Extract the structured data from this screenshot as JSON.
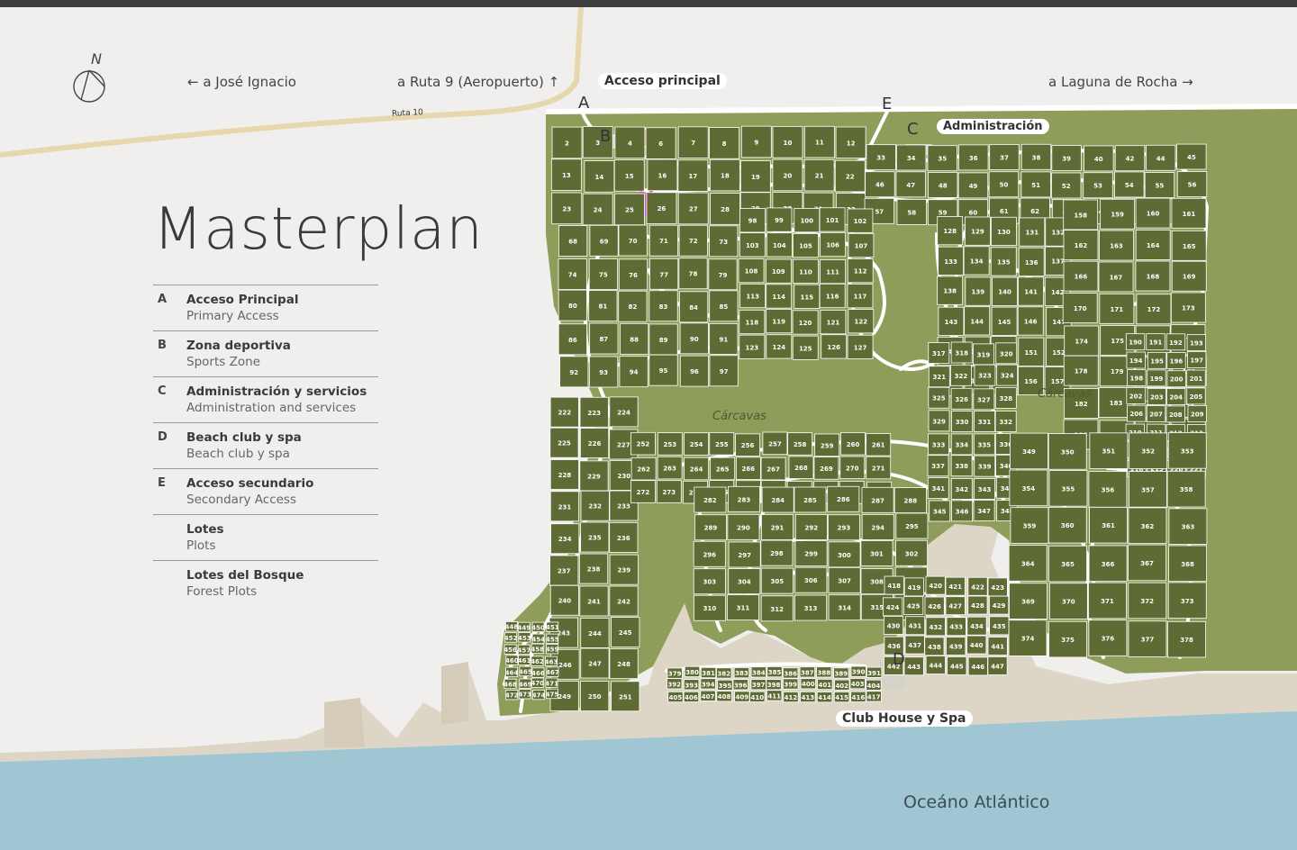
{
  "title": "Masterplan",
  "legend": [
    {
      "key": "A",
      "es": "Acceso Principal",
      "en": "Primary Access"
    },
    {
      "key": "B",
      "es": "Zona deportiva",
      "en": "Sports Zone"
    },
    {
      "key": "C",
      "es": "Administración y servicios",
      "en": "Administration and services"
    },
    {
      "key": "D",
      "es": "Beach club y spa",
      "en": "Beach club y spa"
    },
    {
      "key": "E",
      "es": "Acceso secundario",
      "en": "Secondary Access"
    },
    {
      "key": "",
      "es": "Lotes",
      "en": "Plots"
    },
    {
      "key": "",
      "es": "Lotes del Bosque",
      "en": "Forest Plots"
    }
  ],
  "compass": {
    "label": "N"
  },
  "directions": {
    "jose_ignacio": "← a José Ignacio",
    "ruta9": "a Ruta 9 (Aeropuerto) ↑",
    "laguna": "a Laguna de Rocha →"
  },
  "road_label": "Ruta 10",
  "places": {
    "acceso_principal": "Acceso principal",
    "administracion": "Administración",
    "club_house": "Club House y Spa",
    "ocean": "Oceáno Atlántico",
    "carcavas_1": "Cárcavas",
    "carcavas_2": "Cárcavas"
  },
  "points": {
    "A": "A",
    "B": "B",
    "C": "C",
    "D": "D",
    "E": "E"
  },
  "colors": {
    "background": "#f0efed",
    "land": "#8f9d5b",
    "plots": "#5f6b35",
    "roads": "#ffffff",
    "sand": "#ddd6c6",
    "ocean": "#9fc6d2",
    "highlight": "#d44fd0"
  },
  "plot_numbers": [
    "2",
    "3",
    "4",
    "6",
    "7",
    "8",
    "9",
    "10",
    "11",
    "12",
    "13",
    "14",
    "15",
    "16",
    "17",
    "18",
    "19",
    "20",
    "21",
    "22",
    "23",
    "24",
    "25",
    "26",
    "27",
    "28",
    "29",
    "30",
    "31",
    "32",
    "33",
    "34",
    "35",
    "36",
    "37",
    "38",
    "39",
    "40",
    "42",
    "44",
    "45",
    "46",
    "47",
    "48",
    "49",
    "50",
    "51",
    "52",
    "53",
    "54",
    "55",
    "56",
    "57",
    "58",
    "59",
    "60",
    "61",
    "62",
    "63",
    "64",
    "65",
    "66",
    "67",
    "68",
    "69",
    "70",
    "71",
    "72",
    "73",
    "74",
    "75",
    "76",
    "77",
    "78",
    "79",
    "80",
    "81",
    "82",
    "83",
    "84",
    "85",
    "86",
    "87",
    "88",
    "89",
    "90",
    "91",
    "92",
    "93",
    "94",
    "95",
    "96",
    "97",
    "98",
    "99",
    "100",
    "101",
    "102",
    "103",
    "104",
    "105",
    "106",
    "107",
    "108",
    "109",
    "110",
    "111",
    "112",
    "113",
    "114",
    "115",
    "116",
    "117",
    "118",
    "119",
    "120",
    "121",
    "122",
    "123",
    "124",
    "125",
    "126",
    "127",
    "128",
    "129",
    "130",
    "131",
    "132",
    "133",
    "134",
    "135",
    "136",
    "137",
    "138",
    "139",
    "140",
    "141",
    "142",
    "143",
    "144",
    "145",
    "146",
    "147",
    "148",
    "149",
    "150",
    "151",
    "152",
    "153",
    "154",
    "155",
    "156",
    "157",
    "158",
    "159",
    "160",
    "161",
    "162",
    "163",
    "164",
    "165",
    "166",
    "167",
    "168",
    "169",
    "170",
    "171",
    "172",
    "173",
    "174",
    "175",
    "176",
    "177",
    "178",
    "179",
    "180",
    "181",
    "182",
    "183",
    "184",
    "185",
    "186",
    "187",
    "188",
    "189",
    "190",
    "191",
    "192",
    "193",
    "194",
    "195",
    "196",
    "197",
    "198",
    "199",
    "200",
    "201",
    "202",
    "203",
    "204",
    "205",
    "206",
    "207",
    "208",
    "209",
    "210",
    "211",
    "212",
    "213",
    "214",
    "215",
    "216",
    "217",
    "218",
    "219",
    "220",
    "221",
    "222",
    "223",
    "224",
    "225",
    "226",
    "227",
    "228",
    "229",
    "230",
    "231",
    "232",
    "233",
    "234",
    "235",
    "236",
    "237",
    "238",
    "239",
    "240",
    "241",
    "242",
    "243",
    "244",
    "245",
    "246",
    "247",
    "248",
    "249",
    "250",
    "251",
    "252",
    "253",
    "254",
    "255",
    "256",
    "257",
    "258",
    "259",
    "260",
    "261",
    "262",
    "263",
    "264",
    "265",
    "266",
    "267",
    "268",
    "269",
    "270",
    "271",
    "272",
    "273",
    "274",
    "275",
    "276",
    "277",
    "278",
    "279",
    "280",
    "281",
    "282",
    "283",
    "284",
    "285",
    "286",
    "287",
    "288",
    "289",
    "290",
    "291",
    "292",
    "293",
    "294",
    "295",
    "296",
    "297",
    "298",
    "299",
    "300",
    "301",
    "302",
    "303",
    "304",
    "305",
    "306",
    "307",
    "308",
    "309",
    "310",
    "311",
    "312",
    "313",
    "314",
    "315",
    "316",
    "317",
    "318",
    "319",
    "320",
    "321",
    "322",
    "323",
    "324",
    "325",
    "326",
    "327",
    "328",
    "329",
    "330",
    "331",
    "332",
    "333",
    "334",
    "335",
    "336",
    "337",
    "338",
    "339",
    "340",
    "341",
    "342",
    "343",
    "344",
    "345",
    "346",
    "347",
    "348",
    "349",
    "350",
    "351",
    "352",
    "353",
    "354",
    "355",
    "356",
    "357",
    "358",
    "359",
    "360",
    "361",
    "362",
    "363",
    "364",
    "365",
    "366",
    "367",
    "368",
    "369",
    "370",
    "371",
    "372",
    "373",
    "374",
    "375",
    "376",
    "377",
    "378",
    "379",
    "380",
    "381",
    "382",
    "383",
    "384",
    "385",
    "386",
    "387",
    "388",
    "389",
    "390",
    "391",
    "392",
    "393",
    "394",
    "395",
    "396",
    "397",
    "398",
    "399",
    "400",
    "401",
    "402",
    "403",
    "404",
    "405",
    "406",
    "407",
    "408",
    "409",
    "410",
    "411",
    "412",
    "413",
    "414",
    "415",
    "416",
    "417",
    "418",
    "419",
    "420",
    "421",
    "422",
    "423",
    "424",
    "425",
    "426",
    "427",
    "428",
    "429",
    "430",
    "431",
    "432",
    "433",
    "434",
    "435",
    "436",
    "437",
    "438",
    "439",
    "440",
    "441",
    "442",
    "443",
    "444",
    "445",
    "446",
    "447",
    "448",
    "449",
    "450",
    "451",
    "452",
    "453",
    "454",
    "455",
    "456",
    "457",
    "458",
    "459",
    "460",
    "461",
    "462",
    "463",
    "464",
    "465",
    "466",
    "467",
    "468",
    "469",
    "470",
    "471",
    "472",
    "473",
    "474",
    "475"
  ]
}
